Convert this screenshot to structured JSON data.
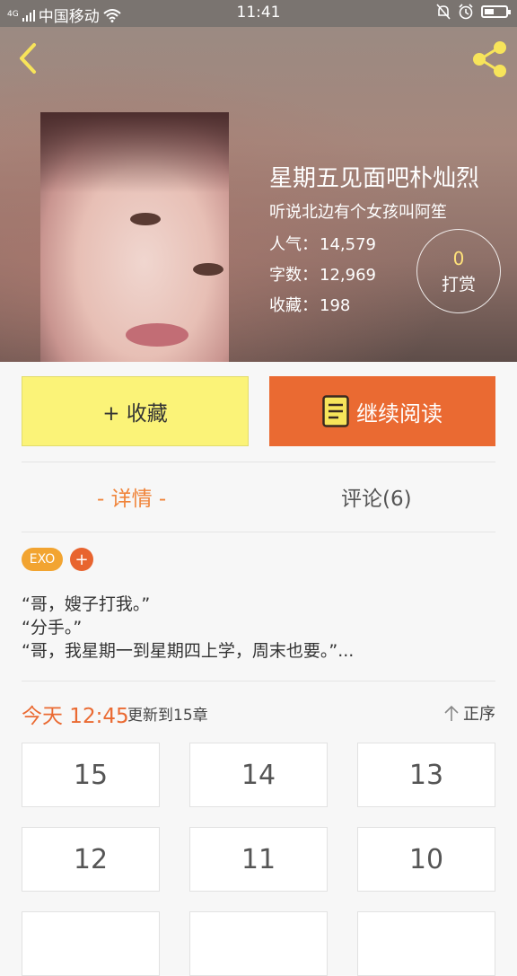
{
  "status_bar": {
    "network": "4G",
    "carrier": "中国移动",
    "time": "11:41"
  },
  "book": {
    "title": "星期五见面吧朴灿烈",
    "author": "听说北边有个女孩叫阿笙",
    "stats": [
      {
        "label": "人气：",
        "value": "14,579"
      },
      {
        "label": "字数：",
        "value": "12,969"
      },
      {
        "label": "收藏：",
        "value": "198"
      }
    ],
    "reward": {
      "count": "0",
      "label": "打赏"
    }
  },
  "actions": {
    "favorite_label": "+ 收藏",
    "read_label": "继续阅读"
  },
  "tabs": {
    "details": "- 详情 -",
    "comments": "评论(6)"
  },
  "tags": {
    "exo": "EXO",
    "add": "+"
  },
  "summary": [
    "“哥，嫂子打我。”",
    "“分手。”",
    "“哥，我星期一到星期四上学，周末也要。”..."
  ],
  "update": {
    "today": "今天 12:45",
    "updated_to": "更新到15章",
    "sort_label": "正序"
  },
  "chapters": [
    "15",
    "14",
    "13",
    "12",
    "11",
    "10"
  ],
  "colors": {
    "accent_orange": "#ea6a32",
    "favorite_yellow": "#fbf378",
    "tab_active": "#f0843a",
    "tag_exo": "#f2a431",
    "icon_yellow": "#f7e45a"
  }
}
